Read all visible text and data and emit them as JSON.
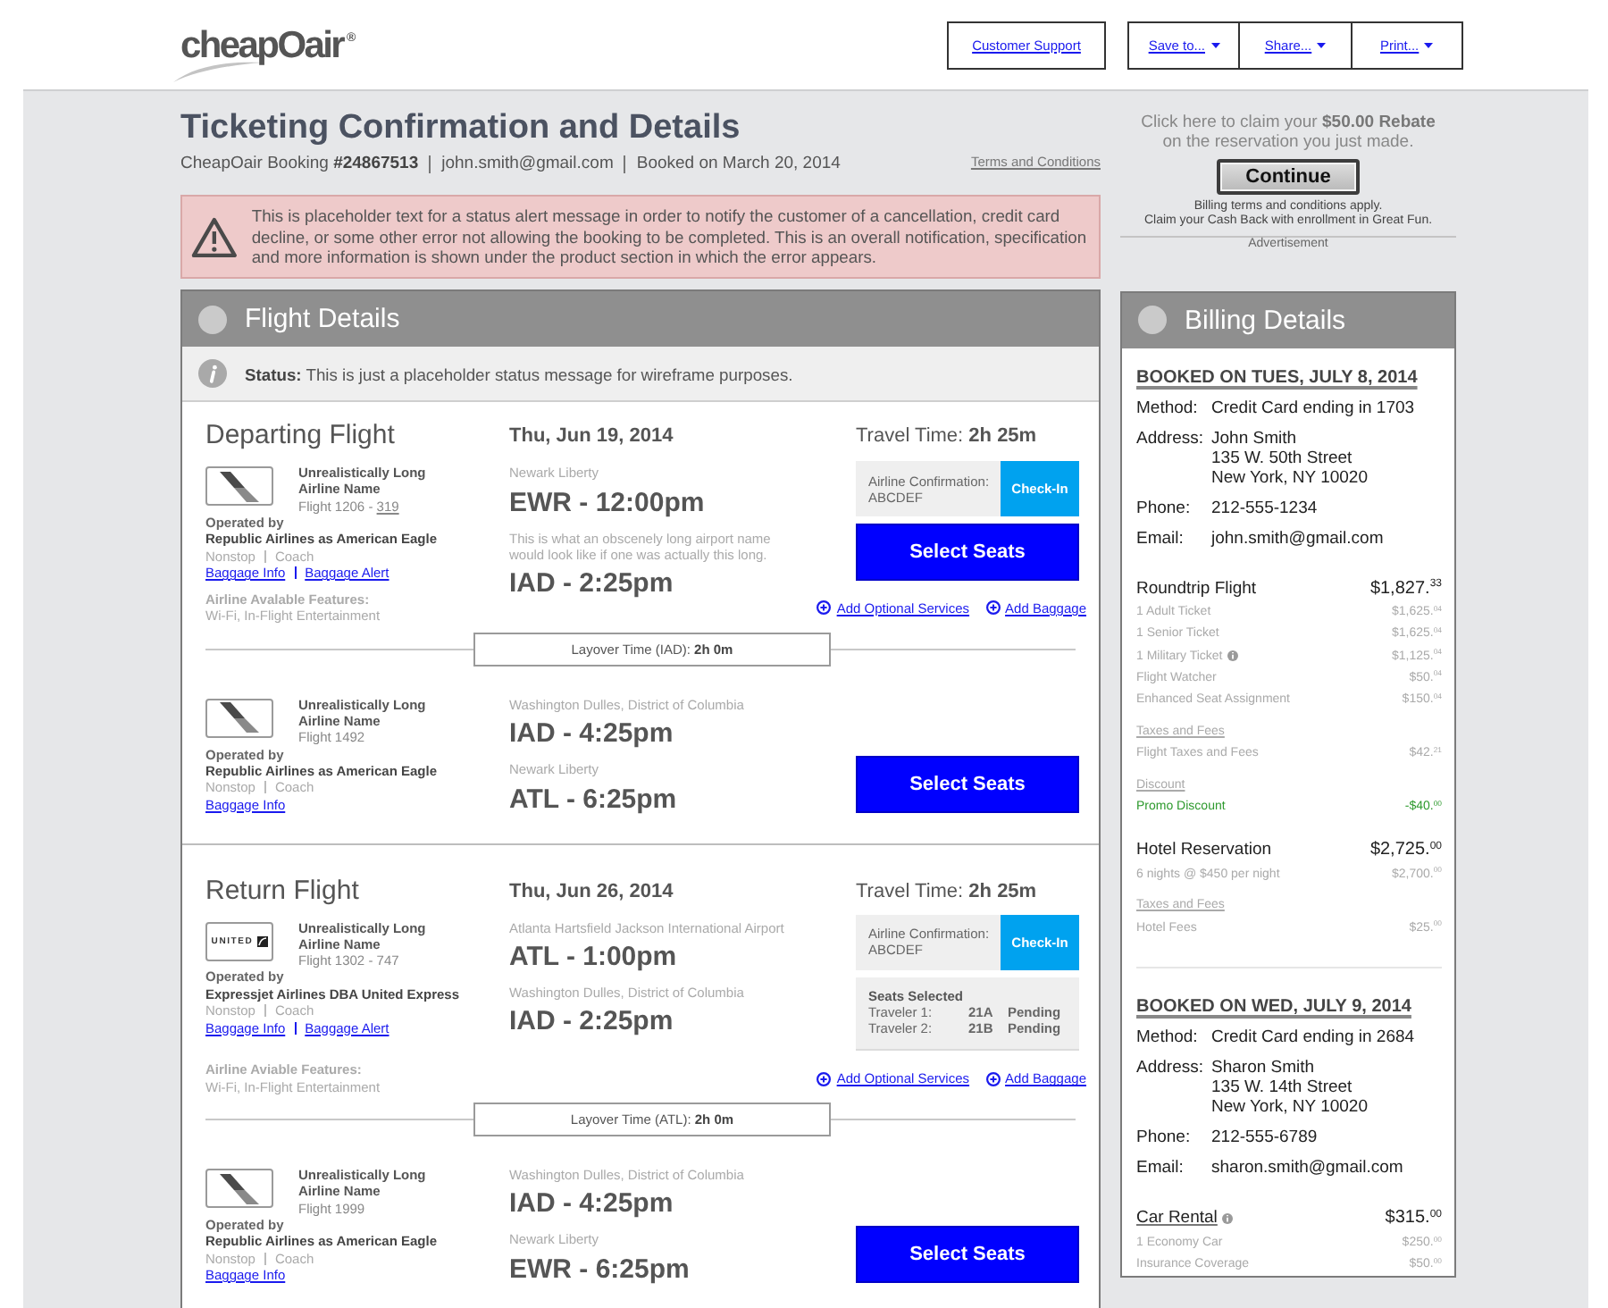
{
  "header": {
    "logo": "cheapOair",
    "registered_mark": "®",
    "support_link": "Customer Support",
    "menus": [
      {
        "label": "Save to...",
        "dropdown": true
      },
      {
        "label": "Share...",
        "dropdown": true
      },
      {
        "label": "Print...",
        "dropdown": true
      }
    ]
  },
  "page": {
    "title": "Ticketing Confirmation and Details",
    "booking_info": [
      "CheapOair Booking **#24867513**",
      "john.smith@gmail.com",
      "Booked on March 20, 2014"
    ],
    "terms_link": "Terms and Conditions"
  },
  "alert": {
    "text": "This is placeholder text for a status alert message in order to notify the customer of a cancellation, credit card decline, or some other error not allowing the booking to be completed. This is an overall notification, specification and more information is shown under the product section in which the error appears."
  },
  "ad": {
    "headline": [
      "Click here to claim your **$50.00 Rebate**",
      "on the reservation you just made."
    ],
    "button": "Continue",
    "fine_print": [
      "Billing terms and conditions apply.",
      "Claim your Cash Back with enrollment in Great Fun."
    ],
    "label": "Advertisement"
  },
  "flight_details": {
    "title": "Flight Details",
    "status": "**Status:** This is just a placeholder status message for wireframe purposes.",
    "trips": [
      {
        "heading": "Departing Flight",
        "date": "Thu, Jun 19, 2014",
        "travel_time": "Travel Time: **2h 25m**",
        "layover": "Layover Time (IAD): **2h 0m**",
        "segments": [
          {
            "logo": {
              "kind": "stripes"
            },
            "airline": "Unrealistically Long Airline Name",
            "flight": "Flight 1206 -",
            "aircraft_link": "319",
            "operated_label": "Operated by",
            "operator": "Republic Airlines as American Eagle",
            "service": [
              "Nonstop",
              "Coach"
            ],
            "links": [
              "Baggage Info",
              "Baggage Alert"
            ],
            "features": {
              "label": "Airline Avalable Features:",
              "value": "Wi-Fi, In-Flight Entertainment"
            },
            "depart": {
              "airport": "Newark Liberty",
              "time": "EWR - 12:00pm"
            },
            "arrive": {
              "airport": "This is what an obscenely long airport name would look like if one was actually this long.",
              "time": "IAD - 2:25pm"
            },
            "actions": [
              {
                "kind": "confirmation",
                "label": "Airline Confirmation:",
                "code": "ABCDEF",
                "button": "Check-In"
              },
              {
                "kind": "select_seats",
                "label": "Select Seats"
              }
            ],
            "extras": [
              "Add Optional Services",
              "Add Baggage"
            ]
          },
          {
            "logo": {
              "kind": "stripes"
            },
            "airline": "Unrealistically Long Airline Name",
            "flight": "Flight 1492",
            "operated_label": "Operated by",
            "operator": "Republic Airlines as American Eagle",
            "service": [
              "Nonstop",
              "Coach"
            ],
            "links": [
              "Baggage Info"
            ],
            "depart": {
              "airport": "Washington Dulles, District of Columbia",
              "time": "IAD - 4:25pm"
            },
            "arrive": {
              "airport": "Newark Liberty",
              "time": "ATL - 6:25pm"
            },
            "actions": [
              {
                "kind": "select_seats",
                "label": "Select Seats"
              }
            ]
          }
        ]
      },
      {
        "heading": "Return Flight",
        "date": "Thu, Jun 26, 2014",
        "travel_time": "Travel Time: **2h 25m**",
        "layover": "Layover Time (ATL): **2h 0m**",
        "segments": [
          {
            "logo": {
              "kind": "united",
              "text": "UNITED"
            },
            "airline": "Unrealistically Long Airline Name",
            "flight": "Flight 1302 - 747",
            "operated_label": "Operated by",
            "operator": "Expressjet Airlines DBA United Express",
            "service": [
              "Nonstop",
              "Coach"
            ],
            "links": [
              "Baggage Info",
              "Baggage Alert"
            ],
            "features": {
              "label": "Airline Aviable Features:",
              "value": "Wi-Fi, In-Flight Entertainment"
            },
            "depart": {
              "airport": "Atlanta Hartsfield Jackson International Airport",
              "time": "ATL - 1:00pm"
            },
            "arrive": {
              "airport": "Washington Dulles, District of Columbia",
              "time": "IAD - 2:25pm"
            },
            "actions": [
              {
                "kind": "confirmation",
                "label": "Airline Confirmation:",
                "code": "ABCDEF",
                "button": "Check-In"
              },
              {
                "kind": "seats",
                "title": "Seats Selected",
                "travelers": [
                  {
                    "name": "Traveler 1:",
                    "seat": "21A",
                    "status": "Pending"
                  },
                  {
                    "name": "Traveler 2:",
                    "seat": "21B",
                    "status": "Pending"
                  }
                ]
              }
            ],
            "extras": [
              "Add Optional Services",
              "Add Baggage"
            ]
          },
          {
            "logo": {
              "kind": "stripes"
            },
            "airline": "Unrealistically Long Airline Name",
            "flight": "Flight 1999",
            "operated_label": "Operated by",
            "operator": "Republic Airlines as American Eagle",
            "service": [
              "Nonstop",
              "Coach"
            ],
            "links": [
              "Baggage Info"
            ],
            "depart": {
              "airport": "Washington Dulles, District of Columbia",
              "time": "IAD - 4:25pm"
            },
            "arrive": {
              "airport": "Newark Liberty",
              "time": "EWR - 6:25pm"
            },
            "actions": [
              {
                "kind": "select_seats",
                "label": "Select Seats"
              }
            ]
          }
        ]
      }
    ]
  },
  "billing": {
    "title": "Billing Details",
    "bookings": [
      {
        "heading": "BOOKED ON TUES, JULY 8, 2014",
        "details": [
          {
            "label": "Method:",
            "lines": [
              "Credit Card ending in 1703"
            ]
          },
          {
            "label": "Address:",
            "lines": [
              "John Smith",
              "135 W. 50th Street",
              "New York, NY 10020"
            ]
          },
          {
            "label": "Phone:",
            "lines": [
              "212-555-1234"
            ]
          },
          {
            "label": "Email:",
            "lines": [
              "john.smith@gmail.com"
            ]
          }
        ],
        "products": [
          {
            "name": "Roundtrip Flight",
            "total": "$1,827.$^{33}$",
            "lines": [
              {
                "kind": "item",
                "label": "1 Adult Ticket",
                "amount": "$1,625.$^{04}$"
              },
              {
                "kind": "item",
                "label": "1 Senior Ticket",
                "amount": "$1,625.$^{04}$"
              },
              {
                "kind": "item",
                "label": "1 Military Ticket",
                "info": true,
                "amount": "$1,125.$^{04}$"
              },
              {
                "kind": "item",
                "label": "Flight Watcher",
                "amount": "$50.$^{04}$"
              },
              {
                "kind": "item",
                "label": "Enhanced Seat Assignment",
                "amount": "$150.$^{04}$"
              },
              {
                "kind": "subheading",
                "label": "Taxes and Fees"
              },
              {
                "kind": "item",
                "label": "Flight Taxes and Fees",
                "amount": "$42.$^{21}$"
              },
              {
                "kind": "subheading",
                "label": "Discount"
              },
              {
                "kind": "discount",
                "label": "Promo Discount",
                "amount": "-$40.$^{00}$"
              }
            ]
          },
          {
            "name": "Hotel Reservation",
            "total": "$2,725.$^{00}$",
            "lines": [
              {
                "kind": "item",
                "label": "6 nights @ $450 per night",
                "amount": "$2,700.$^{00}$"
              },
              {
                "kind": "subheading",
                "label": "Taxes and Fees"
              },
              {
                "kind": "item",
                "label": "Hotel Fees",
                "amount": "$25.$^{00}$"
              }
            ]
          }
        ]
      },
      {
        "heading": "BOOKED ON WED, JULY 9, 2014",
        "details": [
          {
            "label": "Method:",
            "lines": [
              "Credit Card ending in 2684"
            ]
          },
          {
            "label": "Address:",
            "lines": [
              "Sharon Smith",
              "135 W. 14th Street",
              "New York, NY 10020"
            ]
          },
          {
            "label": "Phone:",
            "lines": [
              "212-555-6789"
            ]
          },
          {
            "label": "Email:",
            "lines": [
              "sharon.smith@gmail.com"
            ]
          }
        ],
        "products": [
          {
            "name": "Car Rental",
            "linked": true,
            "info": true,
            "total": "$315.$^{00}$",
            "lines": [
              {
                "kind": "item",
                "label": "1 Economy Car",
                "amount": "$250.$^{00}$"
              },
              {
                "kind": "item",
                "label": "Insurance Coverage",
                "amount": "$50.$^{00}$"
              }
            ]
          }
        ]
      }
    ]
  }
}
